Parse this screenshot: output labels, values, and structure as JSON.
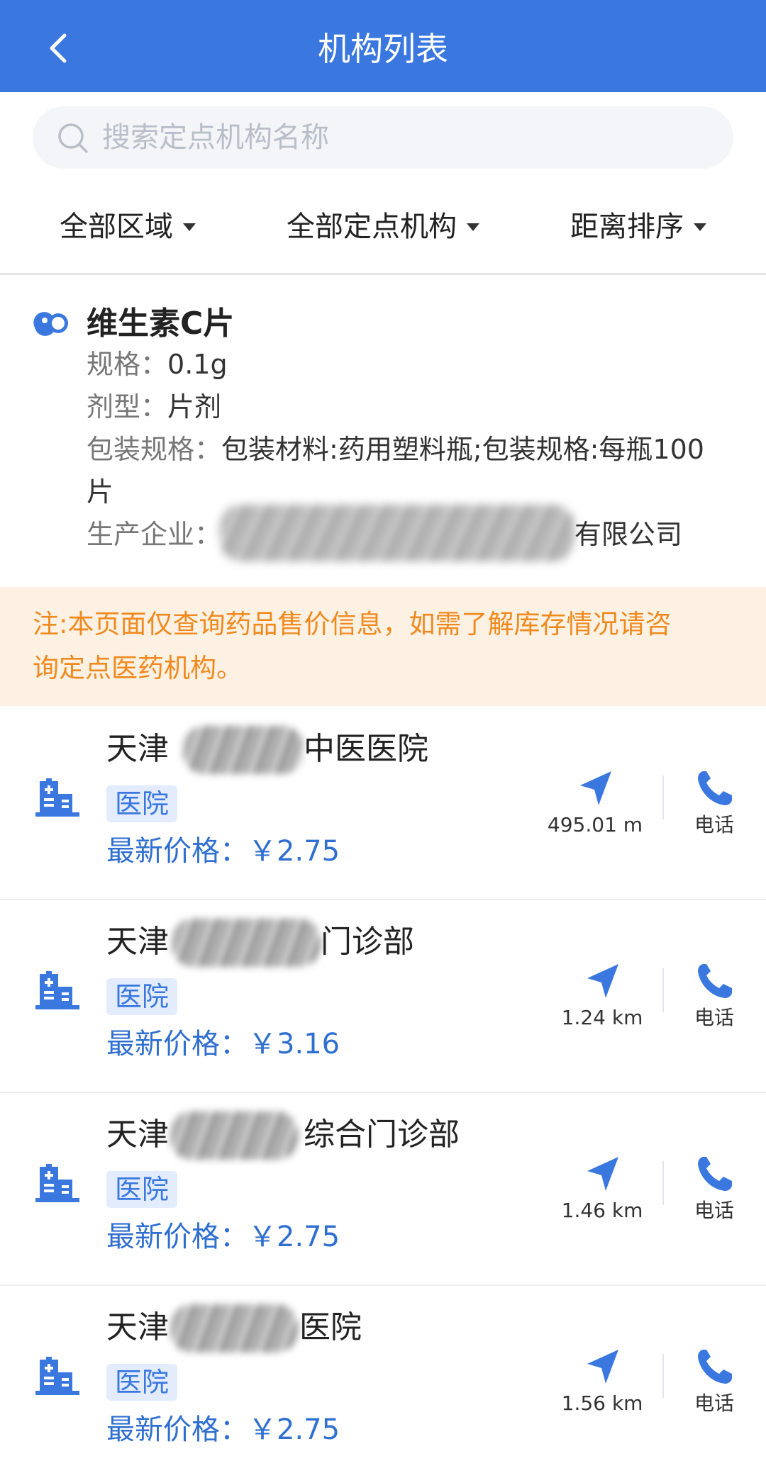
{
  "header": {
    "title": "机构列表"
  },
  "search": {
    "placeholder": "搜索定点机构名称"
  },
  "filters": [
    "全部区域",
    "全部定点机构",
    "距离排序"
  ],
  "drug": {
    "name": "维生素C片",
    "spec_label": "规格：",
    "spec_value": "0.1g",
    "form_label": "剂型：",
    "form_value": "片剂",
    "pack_label": "包装规格：",
    "pack_value_line1": "包装材料:药用塑料瓶;包装规格:每瓶100",
    "pack_value_line2": "片",
    "maker_label": "生产企业：",
    "maker_value_visible": "有限公司"
  },
  "notice": {
    "line1": "注:本页面仅查询药品售价信息，如需了解库存情况请咨",
    "line2": "询定点医药机构。"
  },
  "orgs": [
    {
      "name_prefix": "天津",
      "name_suffix": "中医医院",
      "tag": "医院",
      "price": "最新价格：￥2.75",
      "distance": "495.01 m",
      "call": "电话"
    },
    {
      "name_prefix": "天津",
      "name_suffix": "门诊部",
      "tag": "医院",
      "price": "最新价格：￥3.16",
      "distance": "1.24 km",
      "call": "电话"
    },
    {
      "name_prefix": "天津",
      "name_suffix": "综合门诊部",
      "tag": "医院",
      "price": "最新价格：￥2.75",
      "distance": "1.46 km",
      "call": "电话"
    },
    {
      "name_prefix": "天津",
      "name_suffix": "医院",
      "tag": "医院",
      "price": "最新价格：￥2.75",
      "distance": "1.56 km",
      "call": "电话"
    }
  ],
  "colors": {
    "primary": "#3a78e0",
    "notice_bg": "#fdf1e4",
    "notice_text": "#f08a1f"
  }
}
